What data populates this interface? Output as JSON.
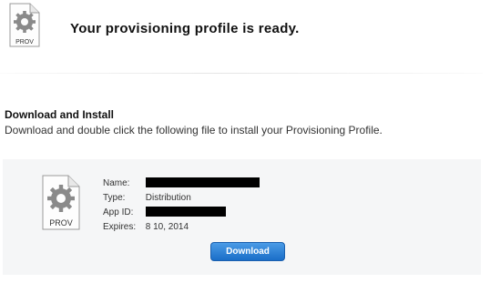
{
  "header": {
    "icon": "prov-file-icon",
    "icon_label": "PROV",
    "title": "Your provisioning profile is ready."
  },
  "section": {
    "heading": "Download and Install",
    "instructions": "Download and double click the following file to install your Provisioning Profile."
  },
  "profile": {
    "icon": "prov-file-icon",
    "icon_label": "PROV",
    "details": {
      "name_label": "Name:",
      "type_label": "Type:",
      "type_value": "Distribution",
      "app_id_label": "App ID:",
      "expires_label": "Expires:",
      "expires_value": "8 10, 2014"
    },
    "download_label": "Download"
  },
  "colors": {
    "button_top": "#4a9be6",
    "button_bottom": "#1a6ec8",
    "panel_background": "#f5f6f7"
  }
}
